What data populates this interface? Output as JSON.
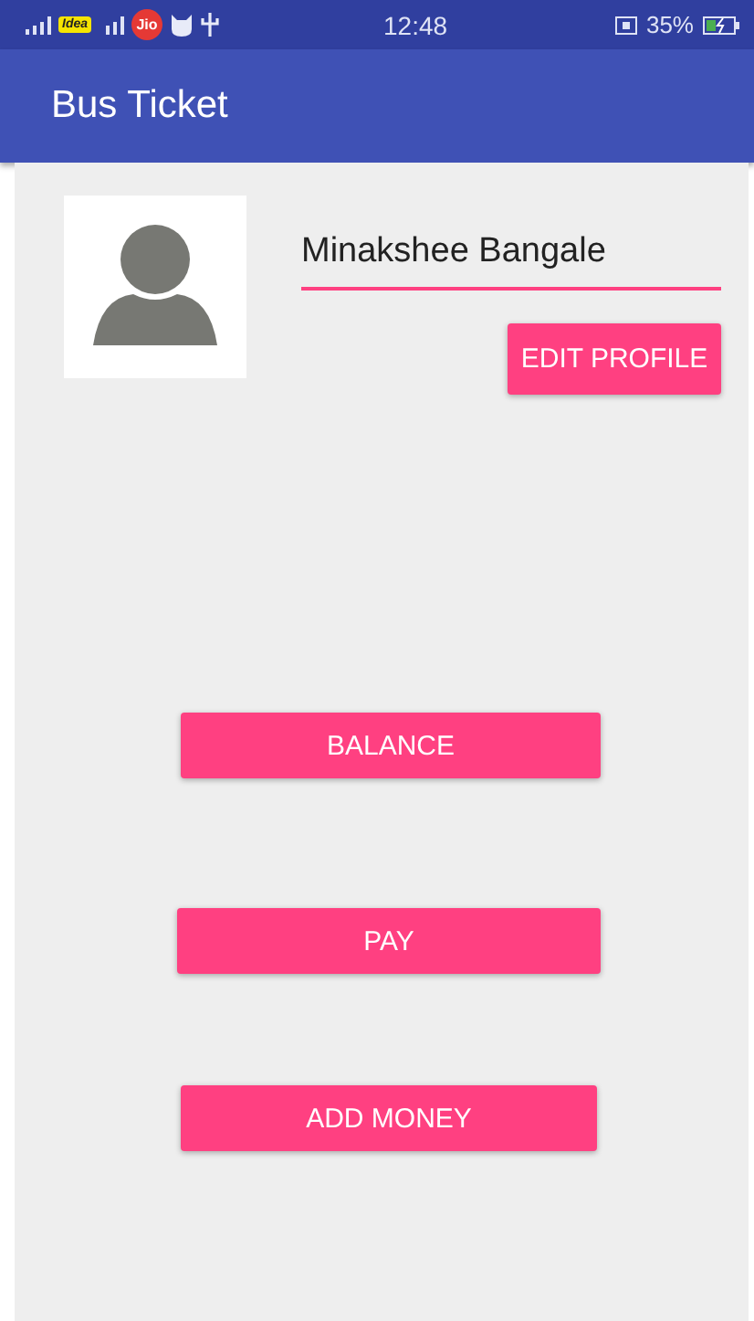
{
  "status_bar": {
    "carrier_badge": "Idea",
    "jio_badge": "Jio",
    "time": "12:48",
    "battery": "35%"
  },
  "app_bar": {
    "title": "Bus Ticket"
  },
  "profile": {
    "name_field": {
      "value": "Minakshee Bangale"
    },
    "edit_button": "EDIT PROFILE"
  },
  "buttons": [
    "BALANCE",
    "PAY",
    "ADD MONEY"
  ]
}
